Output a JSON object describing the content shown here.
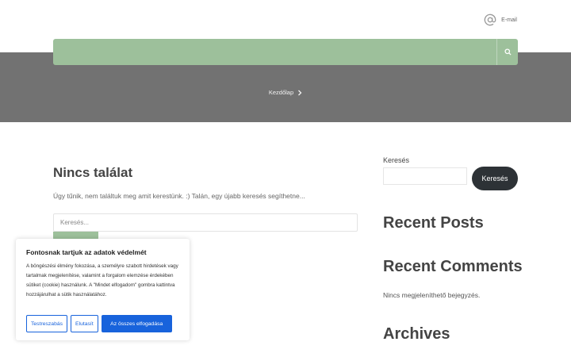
{
  "header": {
    "email_label": "E-mail",
    "icons": {
      "email": "at-sign-icon",
      "search": "search-icon"
    }
  },
  "hero": {
    "breadcrumb": "Kezdőlap",
    "chevron": "chevron-right-icon"
  },
  "main": {
    "title": "Nincs találat",
    "text": "Úgy tűnik, nem találtuk meg amit kerestünk. :) Talán, egy újabb keresés segíthetne...",
    "search_placeholder": "Keresés..."
  },
  "sidebar": {
    "search_label": "Keresés",
    "search_button": "Keresés",
    "recent_posts": "Recent Posts",
    "recent_comments": "Recent Comments",
    "no_comments": "Nincs megjeleníthető bejegyzés.",
    "archives": "Archives"
  },
  "cookie": {
    "title": "Fontosnak tartjuk az adatok védelmét",
    "body": "A böngészési élmény fokozása, a személyre szabott hirdetések vagy tartalmak megjelenítése, valamint a forgalom elemzése érdekében sütiket (cookie) használunk. A \"Mindet elfogadom\" gombra kattintva hozzájárulhat a sütik használatához.",
    "customize": "Testreszabás",
    "reject": "Elutasít",
    "accept_all": "Az összes elfogadása"
  },
  "colors": {
    "nav_green": "#9dc09b",
    "hero_gray": "#727272",
    "dark_button": "#2d3236",
    "cookie_blue": "#1863dc"
  }
}
